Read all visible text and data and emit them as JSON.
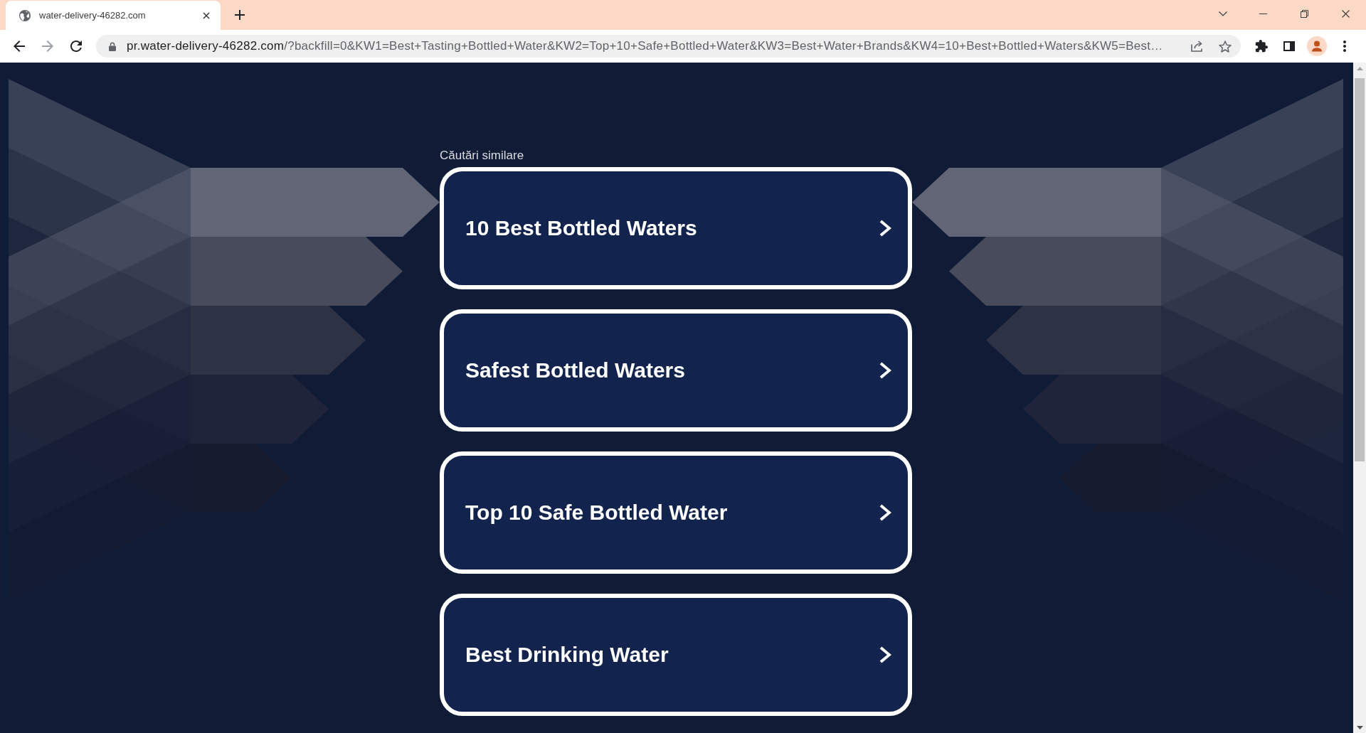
{
  "browser": {
    "tabs": [
      {
        "title": "water-delivery-46282.com",
        "selected": true
      }
    ],
    "address_bar": {
      "host": "pr.water-delivery-46282.com",
      "path": "/?backfill=0&KW1=Best+Tasting+Bottled+Water&KW2=Top+10+Safe+Bottled+Water&KW3=Best+Water+Brands&KW4=10+Best+Bottled+Waters&KW5=Best…"
    }
  },
  "page": {
    "heading": "Căutări similare",
    "related_searches": [
      {
        "label": "10 Best Bottled Waters"
      },
      {
        "label": "Safest Bottled Waters"
      },
      {
        "label": "Top 10 Safe Bottled Water"
      },
      {
        "label": "Best Drinking Water"
      }
    ]
  }
}
